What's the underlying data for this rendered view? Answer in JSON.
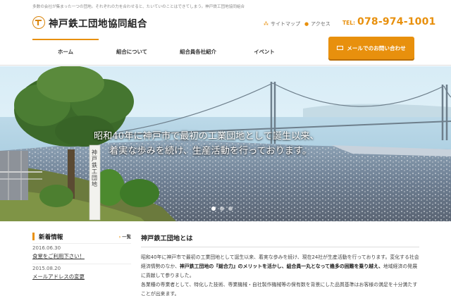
{
  "header": {
    "tagline": "多数の会社が集まった一つの団地。それぞれの力を合わせると、たいていのことはできてしまう。神戸鉄工団地協同組合",
    "logo_text": "神戸鉄工団地協同組合",
    "sitemap_label": "サイトマップ",
    "access_label": "アクセス",
    "tel_label": "TEL:",
    "tel_number": "078-974-1001",
    "contact_button": "メールでのお問い合わせ"
  },
  "nav": {
    "items": [
      {
        "label": "ホーム",
        "active": true
      },
      {
        "label": "組合について",
        "active": false
      },
      {
        "label": "組合員各社紹介",
        "active": false
      },
      {
        "label": "イベント",
        "active": false
      }
    ]
  },
  "hero": {
    "caption_line1": "昭和40年に神戸市で最初の工業団地として誕生以来、",
    "caption_line2": "着実な歩みを続け、生産活動を行っております。",
    "monument_text": "神戸鉄工団地",
    "slide_count": 3,
    "active_slide": 0
  },
  "news": {
    "title": "新着情報",
    "list_link": "一覧",
    "items": [
      {
        "date": "2016.06.30",
        "text": "食堂をご利用下さい！"
      },
      {
        "date": "2015.08.20",
        "text": "メールアドレスの変更"
      }
    ]
  },
  "about": {
    "title": "神戸鉄工団地とは",
    "p1_a": "昭和40年に神戸市で最初の工業団地として誕生以来、着実な歩みを続け、現在24社が生産活動を行っております。変化する社会経済情勢のなか、",
    "p1_b": "神戸鉄工団地の『総合力』のメリットを活かし、組合員一丸となって幾多の困難を乗り越え、",
    "p1_c": "地域経済の発展に貢献して参りました。",
    "p2": "各業種の専業者として、特化した技術、専業機械・自社製作機械等の保有数を背景にした品質基準はお客様の満足を十分満たすことが出来ます。"
  },
  "colors": {
    "accent": "#e8900d"
  }
}
